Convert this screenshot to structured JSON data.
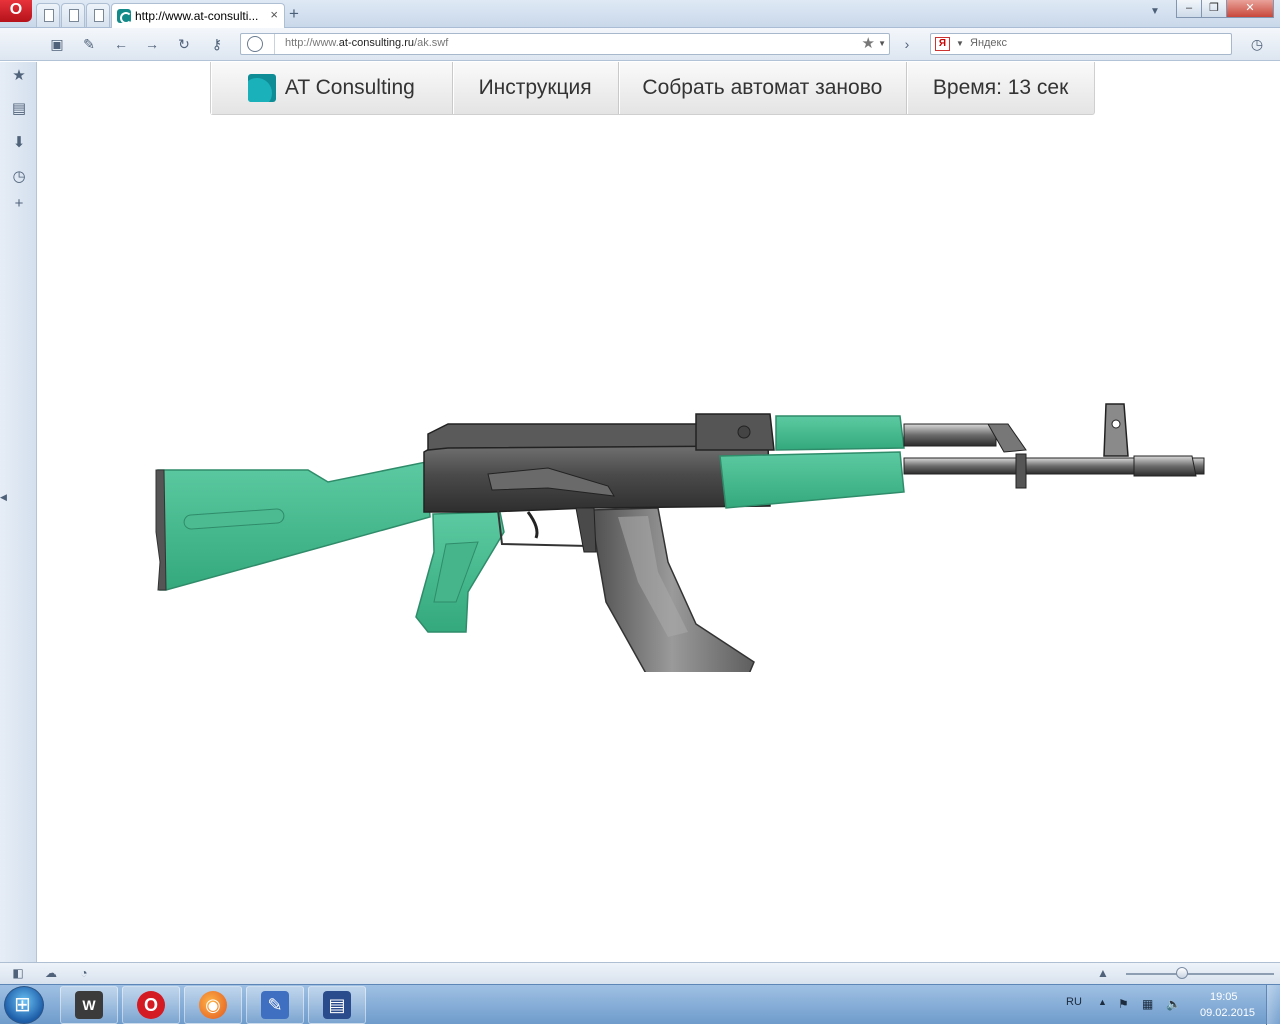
{
  "browser": {
    "tab_title": "http://www.at-consulti...",
    "close_glyph": "×",
    "new_tab_glyph": "+",
    "url_scheme": "http://www.",
    "url_host": "at-consulting.ru",
    "url_path": "/ak.swf",
    "search_engine_badge": "Я",
    "search_placeholder": "Яндекс",
    "buttons": [
      "back",
      "forward",
      "reload",
      "key",
      "bookmark-star",
      "history",
      "downloads",
      "notes"
    ]
  },
  "site_menu": {
    "logo_text": "AT Consulting",
    "instructions": "Инструкция",
    "reassemble": "Собрать автомат заново",
    "timer": "Время: 13 сек"
  },
  "colors": {
    "accent_green": "#3fb98d",
    "metal_dark": "#4a4a4a",
    "brand_teal": "#0f8d96"
  },
  "taskbar": {
    "language": "RU",
    "time": "19:05",
    "date": "09.02.2015",
    "apps": [
      "world-of-tanks-icon",
      "opera-icon",
      "firefox-icon",
      "pen-tool-icon",
      "display-settings-icon"
    ]
  }
}
